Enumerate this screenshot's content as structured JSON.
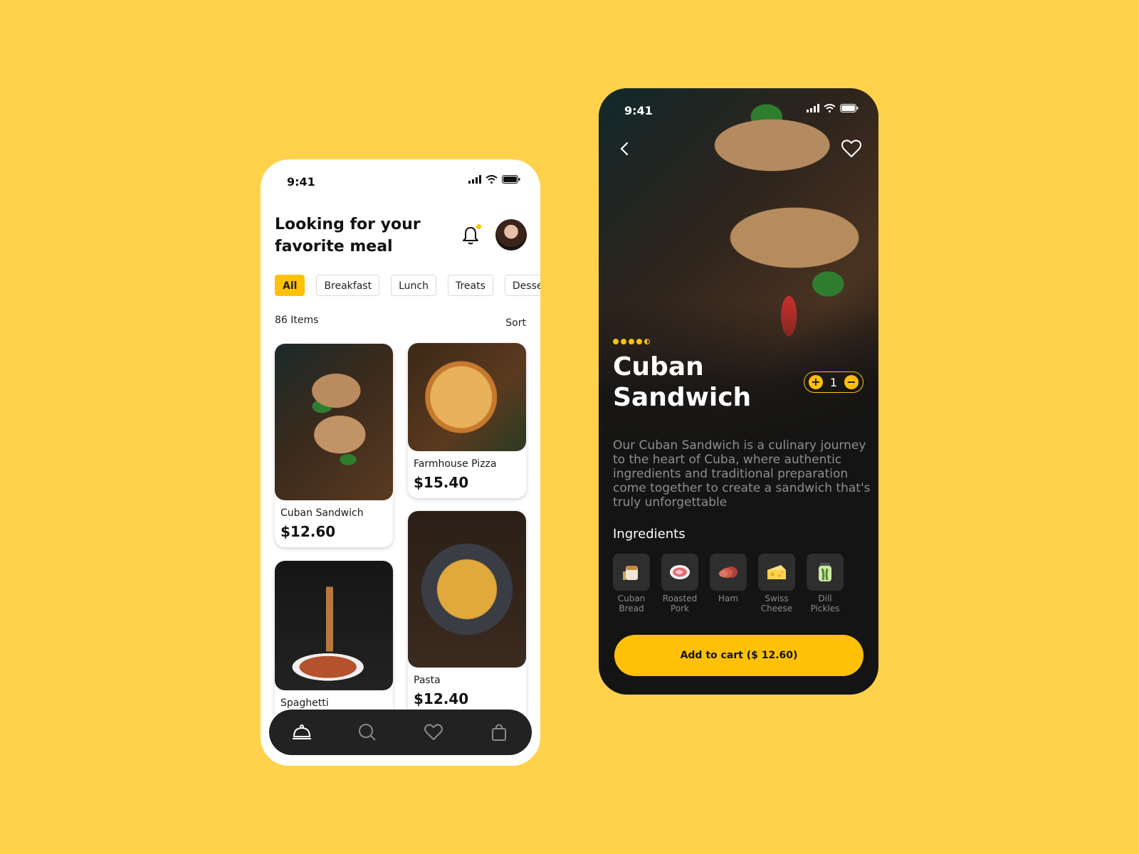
{
  "status_bar": {
    "time": "9:41"
  },
  "home": {
    "headline": "Looking for your favorite meal",
    "categories": [
      "All",
      "Breakfast",
      "Lunch",
      "Treats",
      "Desse"
    ],
    "item_count": "86 Items",
    "sort_label": "Sort",
    "items": [
      {
        "name": "Cuban Sandwich",
        "price": "$12.60"
      },
      {
        "name": "Farmhouse Pizza",
        "price": "$15.40"
      },
      {
        "name": "Spaghetti",
        "price": ""
      },
      {
        "name": "Pasta",
        "price": "$12.40"
      }
    ],
    "nav": [
      "food-cloche-icon",
      "search-icon",
      "heart-icon",
      "shopping-bag-icon"
    ]
  },
  "detail": {
    "rating": 4.5,
    "title": "Cuban Sandwich",
    "quantity": "1",
    "description": "Our Cuban Sandwich is a culinary journey to the heart of Cuba, where authentic ingredients and traditional preparation come together to create a sandwich that's truly unforgettable",
    "ingredients_title": "Ingredients",
    "ingredients": [
      {
        "name": "Cuban Bread",
        "icon": "bread-icon"
      },
      {
        "name": "Roasted Pork",
        "icon": "pork-icon"
      },
      {
        "name": "Ham",
        "icon": "ham-icon"
      },
      {
        "name": "Swiss Cheese",
        "icon": "cheese-icon"
      },
      {
        "name": "Dill Pickles",
        "icon": "pickles-jar-icon"
      }
    ],
    "cart_label": "Add to cart ($ 12.60)"
  },
  "colors": {
    "background": "#FFD24C",
    "accent": "#FFC107",
    "dark": "#141414",
    "navbar": "#222222"
  }
}
